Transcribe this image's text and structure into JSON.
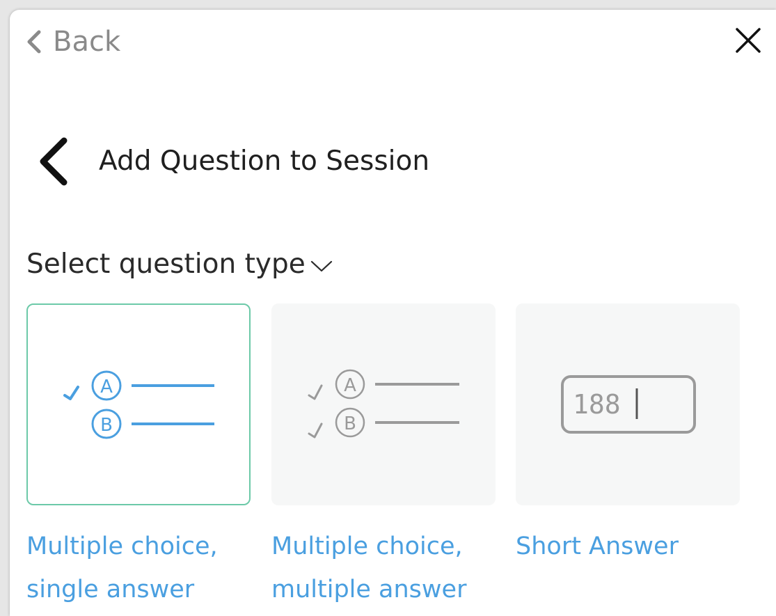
{
  "header": {
    "back_label": "Back",
    "close_icon": "close-icon",
    "back_icon": "chevron-left-icon"
  },
  "heading": {
    "title": "Add Question to Session",
    "back_icon": "chevron-left-icon"
  },
  "question_type": {
    "label": "Select question type",
    "dropdown_icon": "chevron-down-icon"
  },
  "options": [
    {
      "line1": "Multiple choice,",
      "line2": "single answer",
      "icon": "single-answer-icon",
      "selected": true
    },
    {
      "line1": "Multiple choice,",
      "line2": "multiple answer",
      "icon": "multiple-answer-icon",
      "selected": false
    },
    {
      "line1": "Short Answer",
      "line2": "",
      "icon": "short-answer-icon",
      "selected": false,
      "sample_value": "188"
    }
  ],
  "colors": {
    "accent_blue": "#4a9fe0",
    "selected_border": "#6cc9a8",
    "muted_gray": "#9a9a9a",
    "card_background": "#f6f7f7"
  }
}
